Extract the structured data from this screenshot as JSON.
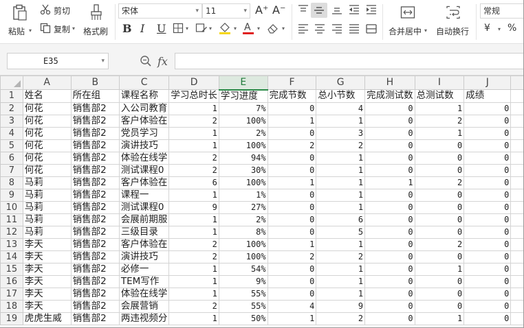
{
  "ribbon": {
    "paste_label": "粘贴",
    "cut_label": "剪切",
    "copy_label": "复制",
    "format_painter_label": "格式刷",
    "font_name": "宋体",
    "font_size": "11",
    "merge_label": "合并居中",
    "wrap_label": "自动换行",
    "number_format": "常规",
    "currency_symbol": "¥",
    "percent_symbol": "%",
    "bold_label": "B",
    "italic_label": "I",
    "underline_label": "U",
    "grow_font_label": "A⁺",
    "shrink_font_label": "A⁻",
    "font_color": "#e02020",
    "fill_color": "#f5d60a"
  },
  "formula_bar": {
    "name_box": "E35",
    "fx_label": "fx",
    "formula": ""
  },
  "sheet": {
    "columns": [
      "A",
      "B",
      "C",
      "D",
      "E",
      "F",
      "G",
      "H",
      "I",
      "J"
    ],
    "active_column": "E",
    "rows": [
      {
        "n": "1",
        "cells": [
          "姓名",
          "所在组",
          "课程名称",
          "学习总时长",
          "学习进度",
          "完成节数",
          "总小节数",
          "完成测试数",
          "总测试数",
          "成绩"
        ]
      },
      {
        "n": "2",
        "cells": [
          "何花",
          "销售部2",
          "入公司教育",
          "1",
          "7%",
          "0",
          "4",
          "0",
          "1",
          "0"
        ]
      },
      {
        "n": "3",
        "cells": [
          "何花",
          "销售部2",
          "客户体验在",
          "2",
          "100%",
          "1",
          "1",
          "0",
          "2",
          "0"
        ]
      },
      {
        "n": "4",
        "cells": [
          "何花",
          "销售部2",
          "党员学习",
          "1",
          "2%",
          "0",
          "3",
          "0",
          "1",
          "0"
        ]
      },
      {
        "n": "5",
        "cells": [
          "何花",
          "销售部2",
          "演讲技巧",
          "1",
          "100%",
          "2",
          "2",
          "0",
          "0",
          "0"
        ]
      },
      {
        "n": "6",
        "cells": [
          "何花",
          "销售部2",
          "体验在线学",
          "2",
          "94%",
          "0",
          "1",
          "0",
          "0",
          "0"
        ]
      },
      {
        "n": "7",
        "cells": [
          "何花",
          "销售部2",
          "测试课程0",
          "2",
          "30%",
          "0",
          "1",
          "0",
          "0",
          "0"
        ]
      },
      {
        "n": "8",
        "cells": [
          "马莉",
          "销售部2",
          "客户体验在",
          "6",
          "100%",
          "1",
          "1",
          "1",
          "2",
          "0"
        ]
      },
      {
        "n": "9",
        "cells": [
          "马莉",
          "销售部2",
          "课程一",
          "1",
          "1%",
          "0",
          "1",
          "0",
          "0",
          "0"
        ]
      },
      {
        "n": "10",
        "cells": [
          "马莉",
          "销售部2",
          "测试课程0",
          "9",
          "27%",
          "0",
          "1",
          "0",
          "0",
          "0"
        ]
      },
      {
        "n": "11",
        "cells": [
          "马莉",
          "销售部2",
          "会展前期服",
          "1",
          "2%",
          "0",
          "6",
          "0",
          "0",
          "0"
        ]
      },
      {
        "n": "12",
        "cells": [
          "马莉",
          "销售部2",
          "三级目录",
          "1",
          "8%",
          "0",
          "5",
          "0",
          "0",
          "0"
        ]
      },
      {
        "n": "13",
        "cells": [
          "李天",
          "销售部2",
          "客户体验在",
          "2",
          "100%",
          "1",
          "1",
          "0",
          "2",
          "0"
        ]
      },
      {
        "n": "14",
        "cells": [
          "李天",
          "销售部2",
          "演讲技巧",
          "2",
          "100%",
          "2",
          "2",
          "0",
          "0",
          "0"
        ]
      },
      {
        "n": "15",
        "cells": [
          "李天",
          "销售部2",
          "必修一",
          "1",
          "54%",
          "0",
          "1",
          "0",
          "1",
          "0"
        ]
      },
      {
        "n": "16",
        "cells": [
          "李天",
          "销售部2",
          "TEM写作",
          "1",
          "9%",
          "0",
          "1",
          "0",
          "0",
          "0"
        ]
      },
      {
        "n": "17",
        "cells": [
          "李天",
          "销售部2",
          "体验在线学",
          "1",
          "55%",
          "0",
          "1",
          "0",
          "0",
          "0"
        ]
      },
      {
        "n": "18",
        "cells": [
          "李天",
          "销售部2",
          "会展营销",
          "2",
          "55%",
          "4",
          "9",
          "0",
          "0",
          "0"
        ]
      },
      {
        "n": "19",
        "cells": [
          "虎虎生威",
          "销售部2",
          "两违视频分",
          "1",
          "50%",
          "1",
          "2",
          "0",
          "1",
          "0"
        ]
      }
    ]
  }
}
